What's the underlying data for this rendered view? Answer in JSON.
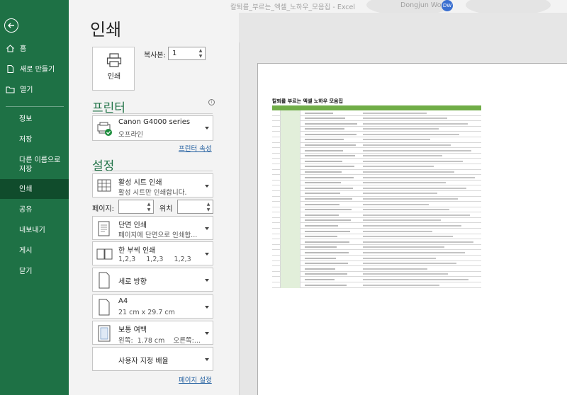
{
  "window": {
    "doc_title": "칼퇴를_부르는_엑셀_노하우_모음집  -  Excel",
    "user_name": "Dongjun Won",
    "user_initials": "DW"
  },
  "sidebar": {
    "back_icon": "back-arrow-icon",
    "items": [
      {
        "label": "홈",
        "icon": "home-icon"
      },
      {
        "label": "새로 만들기",
        "icon": "new-document-icon"
      },
      {
        "label": "열기",
        "icon": "folder-open-icon"
      },
      {
        "label": "정보"
      },
      {
        "label": "저장"
      },
      {
        "label": "다른 이름으로 저장"
      },
      {
        "label": "인쇄",
        "active": true
      },
      {
        "label": "공유"
      },
      {
        "label": "내보내기"
      },
      {
        "label": "게시"
      },
      {
        "label": "닫기"
      }
    ]
  },
  "print": {
    "title": "인쇄",
    "print_button_label": "인쇄",
    "copies_label": "복사본:",
    "copies_value": "1"
  },
  "printer": {
    "heading": "프린터",
    "name": "Canon G4000 series",
    "status": "오프라인",
    "properties_link": "프린터 속성"
  },
  "settings": {
    "heading": "설정",
    "scope_title": "활성 시트 인쇄",
    "scope_desc": "활성 시트만 인쇄합니다.",
    "pages_label": "페이지:",
    "to_label": "위치",
    "sides_title": "단면 인쇄",
    "sides_desc": "페이지에 단면으로 인쇄합...",
    "collate_title": "한 부씩 인쇄",
    "collate_desc": "1,2,3     1,2,3     1,2,3",
    "orientation": "세로 방향",
    "paper_title": "A4",
    "paper_desc": "21 cm x 29.7 cm",
    "margins_title": "보통 여백",
    "margins_desc": "왼쪽:  1.78 cm    오른쪽:...",
    "scaling": "사용자 지정 배율",
    "page_setup_link": "페이지 설정"
  },
  "preview": {
    "sheet_title": "칼퇴를 부르는 엑셀 노하우 모음집"
  },
  "colors": {
    "accent": "#1e7145",
    "accent_dark": "#104c2c",
    "link": "#1e5c9e",
    "sheet_header": "#70ad47"
  }
}
